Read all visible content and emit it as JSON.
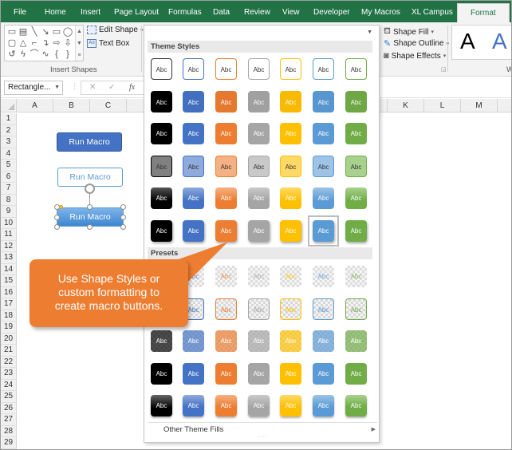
{
  "tabs": [
    {
      "label": "File"
    },
    {
      "label": "Home"
    },
    {
      "label": "Insert"
    },
    {
      "label": "Page Layout"
    },
    {
      "label": "Formulas"
    },
    {
      "label": "Data"
    },
    {
      "label": "Review"
    },
    {
      "label": "View"
    },
    {
      "label": "Developer"
    },
    {
      "label": "My Macros"
    },
    {
      "label": "XL Campus"
    },
    {
      "label": "Format",
      "active": true
    }
  ],
  "ribbon": {
    "insert_shapes_label": "Insert Shapes",
    "edit_shape": "Edit Shape",
    "text_box": "Text Box",
    "shape_fill": "Shape Fill",
    "shape_outline": "Shape Outline",
    "shape_effects": "Shape Effects",
    "wordart_sample_1": "A",
    "wordart_sample_2": "A",
    "wordart_group_partial": "W"
  },
  "formula_bar": {
    "name_box": "Rectangle...",
    "cancel_icon": "✕",
    "enter_icon": "✓",
    "fx_label": "fx"
  },
  "grid": {
    "columns_left": [
      "A",
      "B",
      "C"
    ],
    "columns_right": [
      "K",
      "L",
      "M"
    ],
    "rows": [
      "1",
      "2",
      "3",
      "4",
      "5",
      "6",
      "7",
      "8",
      "9",
      "10",
      "11",
      "12",
      "13",
      "14",
      "15",
      "16",
      "17",
      "18",
      "19",
      "20",
      "21",
      "22",
      "23",
      "24",
      "25",
      "26",
      "27",
      "28",
      "29"
    ]
  },
  "macro_buttons": [
    {
      "label": "Run Macro",
      "style": "solid-blue"
    },
    {
      "label": "Run Macro",
      "style": "outline-blue"
    },
    {
      "label": "Run Macro",
      "style": "gradient-blue-selected"
    }
  ],
  "gallery": {
    "theme_styles_header": "Theme Styles",
    "presets_header": "Presets",
    "cell_text": "Abc",
    "other_theme_fills": "Other Theme Fills",
    "selected": {
      "section": "theme",
      "row": 5,
      "col": 5
    },
    "colors": {
      "dark": "#000000",
      "blue": "#4472c4",
      "orange": "#ed7d31",
      "gray": "#a5a5a5",
      "gold": "#ffc000",
      "lightblue": "#5b9bd5",
      "green": "#70ad47"
    }
  },
  "callout": {
    "text_line_1": "Use Shape Styles or",
    "text_line_2": "custom formatting to",
    "text_line_3": "create macro buttons.",
    "color": "#ed7d31"
  }
}
